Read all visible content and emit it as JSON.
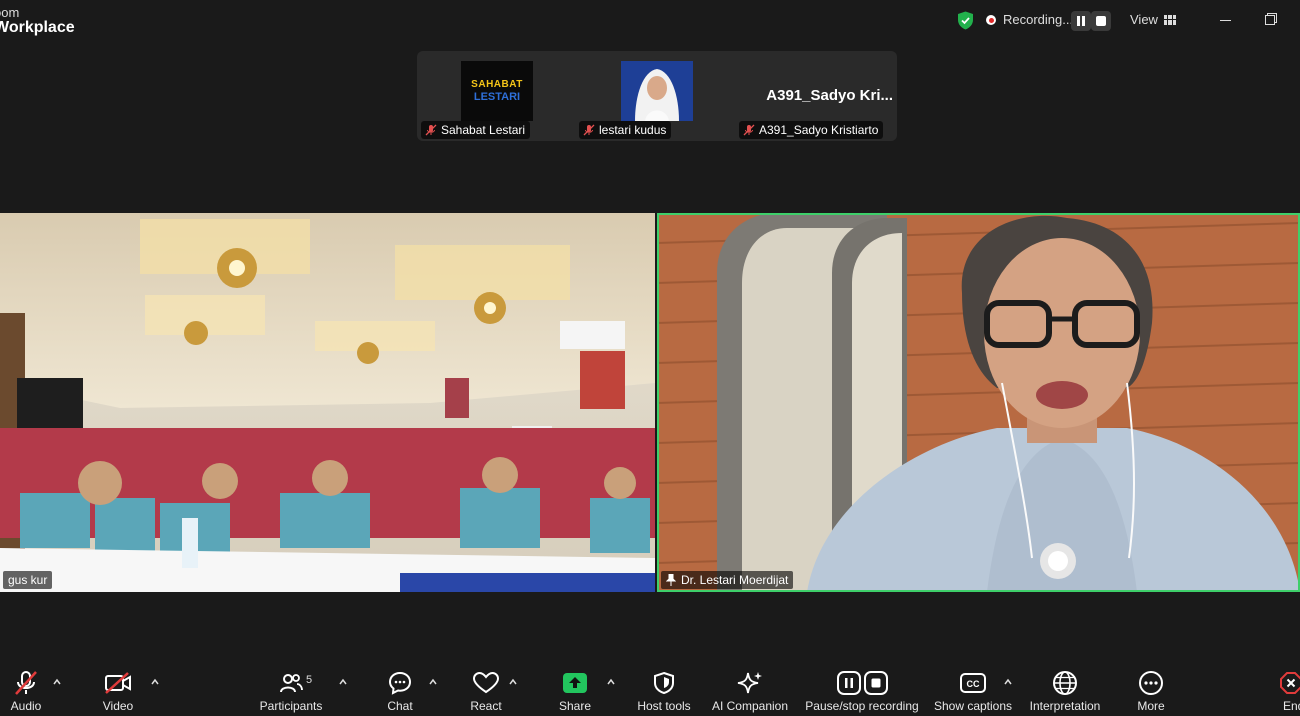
{
  "titlebar": {
    "brand_line1": "oom",
    "brand_line2": "Workplace",
    "recording_text": "Recording...",
    "view_label": "View"
  },
  "gallery": {
    "participants": [
      {
        "name": "Sahabat Lestari",
        "logo_word1": "SAHABAT",
        "logo_word2": "LESTARI"
      },
      {
        "name": "lestari kudus"
      },
      {
        "name": "A391_Sadyo Kristiarto",
        "display": "A391_Sadyo  Kri..."
      }
    ]
  },
  "tiles": {
    "left_name": "gus kur",
    "right_name": "Dr. Lestari Moerdijat"
  },
  "toolbar": {
    "audio": "Audio",
    "video": "Video",
    "participants": "Participants",
    "participants_count": "5",
    "chat": "Chat",
    "react": "React",
    "share": "Share",
    "host_tools": "Host tools",
    "ai_companion": "AI Companion",
    "pause_stop_recording": "Pause/stop recording",
    "show_captions": "Show captions",
    "interpretation": "Interpretation",
    "more": "More",
    "end": "End"
  },
  "colors": {
    "background": "#1a1a1a",
    "active_speaker": "#3ecf6a",
    "share_green": "#22c55e",
    "recording_red": "#e02828",
    "shield_green": "#22b14c"
  },
  "icons": [
    "shield-icon",
    "record-icon",
    "pause-icon",
    "stop-icon",
    "grid-icon",
    "minimize-icon",
    "restore-icon",
    "mic-off-icon",
    "video-off-icon",
    "participants-icon",
    "chat-icon",
    "heart-icon",
    "share-arrow-icon",
    "host-shield-icon",
    "sparkle-icon",
    "captions-icon",
    "globe-icon",
    "more-dots-icon",
    "end-x-icon",
    "pin-icon"
  ]
}
